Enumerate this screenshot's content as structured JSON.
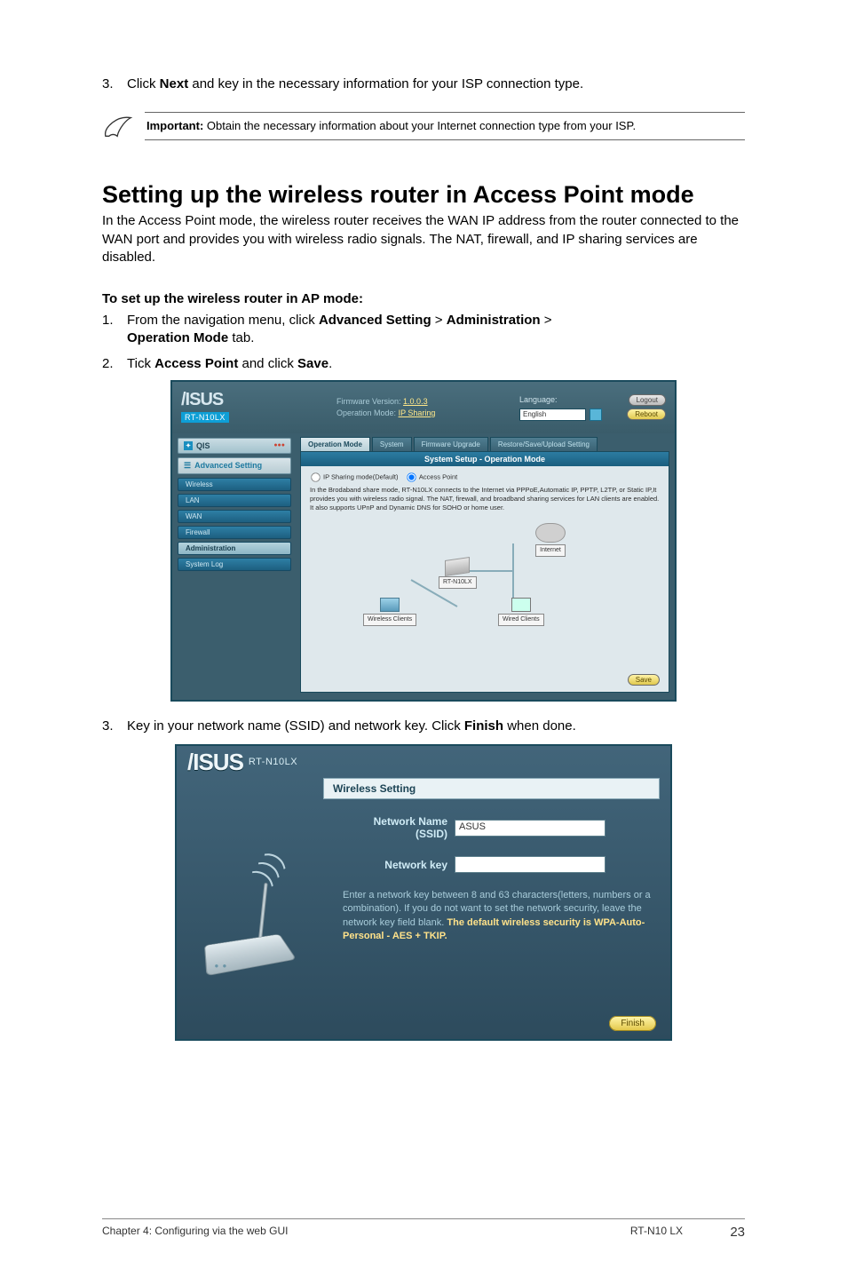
{
  "step3_top": {
    "num": "3.",
    "pre": "Click ",
    "b1": "Next",
    "post": " and key in the necessary information for your ISP connection type."
  },
  "note": {
    "label": "Important:",
    "text": "  Obtain the necessary information about your Internet connection type from your ISP."
  },
  "heading": "Setting up the wireless router in Access Point mode",
  "intro": "In the Access Point mode, the wireless router receives the WAN IP address from the router connected to the WAN port and provides you with wireless radio signals. The NAT, firewall, and IP sharing services are disabled.",
  "subhead": "To set up the wireless router in AP mode:",
  "steps": [
    {
      "num": "1.",
      "pre": "From the navigation menu, click ",
      "b1": "Advanced Setting",
      "mid1": " > ",
      "b2": "Administration",
      "mid2": " > ",
      "b3": "Operation Mode",
      "post": " tab."
    },
    {
      "num": "2.",
      "pre": "Tick ",
      "b1": "Access Point",
      "mid1": " and click ",
      "b2": "Save",
      "post": "."
    },
    {
      "num": "3.",
      "pre": "Key in your network name (SSID) and network key. Click ",
      "b1": "Finish",
      "post": " when done."
    }
  ],
  "scr1": {
    "model": "RT-N10LX",
    "fw_label": "Firmware Version:",
    "fw_ver": "1.0.0.3",
    "opmode_label": "Operation Mode:",
    "opmode_link": "IP Sharing",
    "lang_label": "Language:",
    "lang_value": "English",
    "btn_logout": "Logout",
    "btn_reboot": "Reboot",
    "side_qis": "QIS",
    "side_adv": "Advanced Setting",
    "side_items": [
      "Wireless",
      "LAN",
      "WAN",
      "Firewall",
      "Administration",
      "System Log"
    ],
    "side_active_index": 4,
    "tabs": [
      "Operation Mode",
      "System",
      "Firmware Upgrade",
      "Restore/Save/Upload Setting"
    ],
    "tab_active_index": 0,
    "panel_title": "System Setup - Operation Mode",
    "radio1": "IP Sharing mode(Default)",
    "radio2": "Access Point",
    "desc": "In the Brodaband share mode, RT-N10LX connects to the Internet via PPPoE,Automatic IP, PPTP, L2TP, or Static IP,It provides you with wireless radio signal. The NAT, firewall, and broadband sharing services for LAN clients are enabled. It also supports UPnP and Dynamic DNS for SOHO or home user.",
    "diag_internet": "Internet",
    "diag_router": "RT-N10LX",
    "diag_wireless": "Wireless Clients",
    "diag_wired": "Wired Clients",
    "save": "Save"
  },
  "scr2": {
    "model": "RT-N10LX",
    "box_title": "Wireless Setting",
    "field_name_l1": "Network Name",
    "field_name_l2": "(SSID)",
    "field_name_val": "ASUS",
    "field_key": "Network key",
    "help_l1": "Enter a network key between 8 and 63 characters(letters, numbers or a combination). If you do not want to set the network security, leave the network key field blank. ",
    "help_warn": "The default wireless security is WPA-Auto-Personal - AES + TKIP.",
    "btn_finish": "Finish"
  },
  "footer": {
    "left": "Chapter 4: Configuring via the web GUI",
    "mid": "RT-N10 LX",
    "right": "23"
  }
}
